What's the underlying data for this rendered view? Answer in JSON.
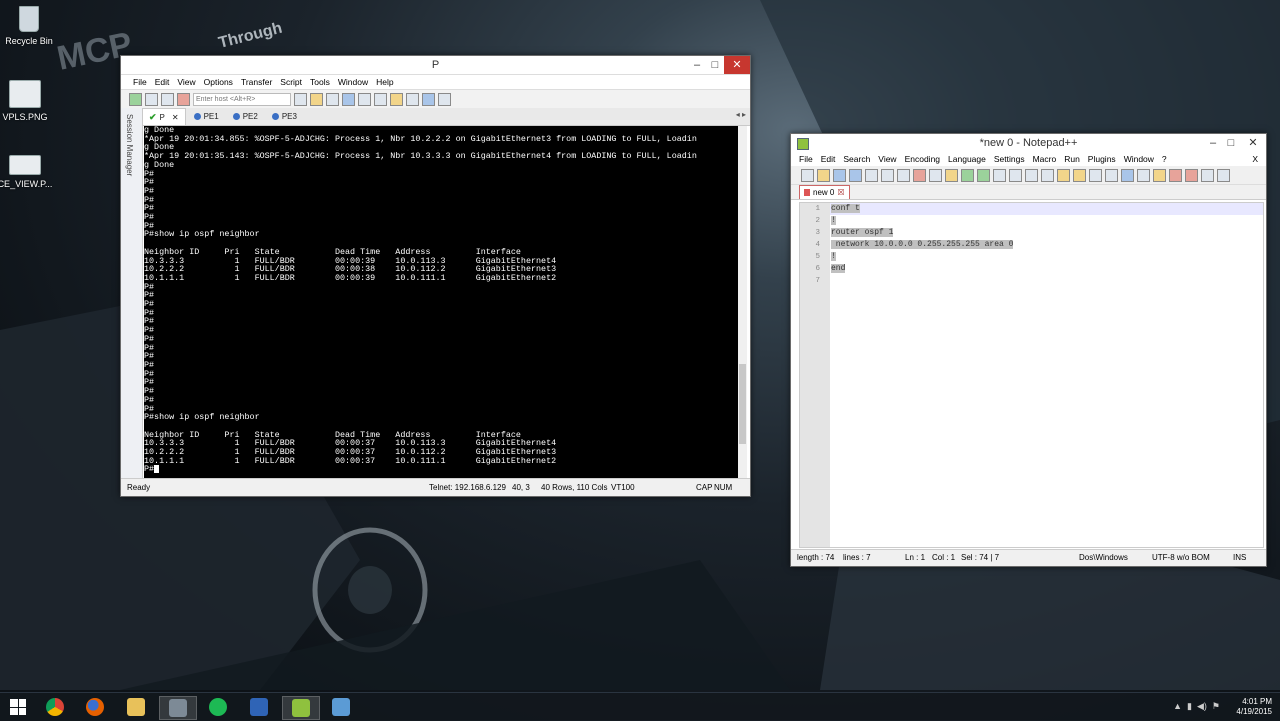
{
  "desktop": {
    "icons": [
      {
        "label": "Recycle Bin"
      },
      {
        "label": "VPLS.PNG"
      },
      {
        "label": "CE_VIEW.P..."
      }
    ],
    "wallpaper_text": "Through"
  },
  "securecrt": {
    "title": "P",
    "menu": [
      "File",
      "Edit",
      "View",
      "Options",
      "Transfer",
      "Script",
      "Tools",
      "Window",
      "Help"
    ],
    "host_placeholder": "Enter host <Alt+R>",
    "session_manager_label": "Session Manager",
    "tabs": [
      {
        "label": "P",
        "active": true
      },
      {
        "label": "PE1",
        "active": false
      },
      {
        "label": "PE2",
        "active": false
      },
      {
        "label": "PE3",
        "active": false
      }
    ],
    "terminal_lines": [
      "g Done",
      "*Apr 19 20:01:34.855: %OSPF-5-ADJCHG: Process 1, Nbr 10.2.2.2 on GigabitEthernet3 from LOADING to FULL, Loadin",
      "g Done",
      "*Apr 19 20:01:35.143: %OSPF-5-ADJCHG: Process 1, Nbr 10.3.3.3 on GigabitEthernet4 from LOADING to FULL, Loadin",
      "g Done",
      "P#",
      "P#",
      "P#",
      "P#",
      "P#",
      "P#",
      "P#",
      "P#show ip ospf neighbor",
      "",
      "Neighbor ID     Pri   State           Dead Time   Address         Interface",
      "10.3.3.3          1   FULL/BDR        00:00:39    10.0.113.3      GigabitEthernet4",
      "10.2.2.2          1   FULL/BDR        00:00:38    10.0.112.2      GigabitEthernet3",
      "10.1.1.1          1   FULL/BDR        00:00:39    10.0.111.1      GigabitEthernet2",
      "P#",
      "P#",
      "P#",
      "P#",
      "P#",
      "P#",
      "P#",
      "P#",
      "P#",
      "P#",
      "P#",
      "P#",
      "P#",
      "P#",
      "P#",
      "P#show ip ospf neighbor",
      "",
      "Neighbor ID     Pri   State           Dead Time   Address         Interface",
      "10.3.3.3          1   FULL/BDR        00:00:37    10.0.113.3      GigabitEthernet4",
      "10.2.2.2          1   FULL/BDR        00:00:37    10.0.112.2      GigabitEthernet3",
      "10.1.1.1          1   FULL/BDR        00:00:37    10.0.111.1      GigabitEthernet2"
    ],
    "prompt": "P#",
    "status": {
      "ready": "Ready",
      "connection": "Telnet: 192.168.6.129",
      "position": "40,  3",
      "size": "40 Rows, 110 Cols",
      "emulation": "VT100",
      "caps": "CAP",
      "num": "NUM"
    }
  },
  "notepadpp": {
    "title": "*new  0 - Notepad++",
    "menu": [
      "File",
      "Edit",
      "Search",
      "View",
      "Encoding",
      "Language",
      "Settings",
      "Macro",
      "Run",
      "Plugins",
      "Window",
      "?"
    ],
    "menu_close": "X",
    "tab_label": "new  0",
    "line_numbers": [
      "1",
      "2",
      "3",
      "4",
      "5",
      "6",
      "7"
    ],
    "lines": [
      "conf t",
      "!",
      "router ospf 1",
      " network 10.0.0.0 0.255.255.255 area 0",
      "!",
      "end",
      ""
    ],
    "status": {
      "length": "length : 74",
      "lines": "lines : 7",
      "ln": "Ln : 1",
      "col": "Col : 1",
      "sel": "Sel : 74 | 7",
      "eol": "Dos\\Windows",
      "encoding": "UTF-8 w/o BOM",
      "mode": "INS"
    }
  },
  "taskbar": {
    "time": "4:01 PM",
    "date": "4/19/2015"
  }
}
